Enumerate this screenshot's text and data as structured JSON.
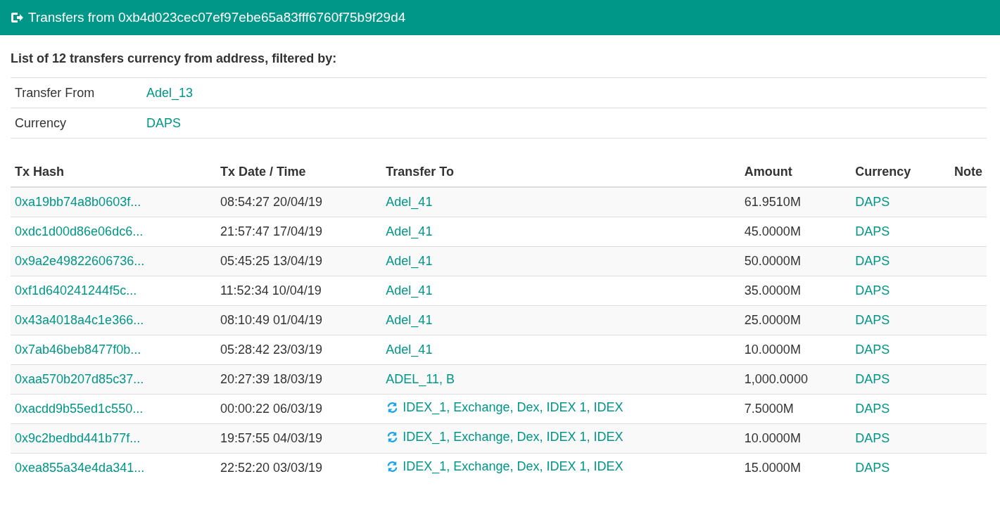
{
  "header": {
    "title": "Transfers from 0xb4d023cec07ef97ebe65a83fff6760f75b9f29d4"
  },
  "summary": {
    "heading": "List of 12 transfers currency from address, filtered by:",
    "filters": [
      {
        "label": "Transfer From",
        "value": "Adel_13"
      },
      {
        "label": "Currency",
        "value": "DAPS"
      }
    ]
  },
  "table": {
    "columns": [
      "Tx Hash",
      "Tx Date / Time",
      "Transfer To",
      "Amount",
      "Currency",
      "Note"
    ],
    "rows": [
      {
        "hash": "0xa19bb74a8b0603f...",
        "time": "08:54:27 20/04/19",
        "to": "Adel_41",
        "exchange": false,
        "amount": "61.9510M",
        "currency": "DAPS"
      },
      {
        "hash": "0xdc1d00d86e06dc6...",
        "time": "21:57:47 17/04/19",
        "to": "Adel_41",
        "exchange": false,
        "amount": "45.0000M",
        "currency": "DAPS"
      },
      {
        "hash": "0x9a2e49822606736...",
        "time": "05:45:25 13/04/19",
        "to": "Adel_41",
        "exchange": false,
        "amount": "50.0000M",
        "currency": "DAPS"
      },
      {
        "hash": "0xf1d640241244f5c...",
        "time": "11:52:34 10/04/19",
        "to": "Adel_41",
        "exchange": false,
        "amount": "35.0000M",
        "currency": "DAPS"
      },
      {
        "hash": "0x43a4018a4c1e366...",
        "time": "08:10:49 01/04/19",
        "to": "Adel_41",
        "exchange": false,
        "amount": "25.0000M",
        "currency": "DAPS"
      },
      {
        "hash": "0x7ab46beb8477f0b...",
        "time": "05:28:42 23/03/19",
        "to": "Adel_41",
        "exchange": false,
        "amount": "10.0000M",
        "currency": "DAPS"
      },
      {
        "hash": "0xaa570b207d85c37...",
        "time": "20:27:39 18/03/19",
        "to": "ADEL_11, B",
        "exchange": false,
        "amount": "1,000.0000",
        "currency": "DAPS"
      },
      {
        "hash": "0xacdd9b55ed1c550...",
        "time": "00:00:22 06/03/19",
        "to": "IDEX_1, Exchange, Dex, IDEX 1, IDEX",
        "exchange": true,
        "amount": "7.5000M",
        "currency": "DAPS"
      },
      {
        "hash": "0x9c2bedbd441b77f...",
        "time": "19:57:55 04/03/19",
        "to": "IDEX_1, Exchange, Dex, IDEX 1, IDEX",
        "exchange": true,
        "amount": "10.0000M",
        "currency": "DAPS"
      },
      {
        "hash": "0xea855a34e4da341...",
        "time": "22:52:20 03/03/19",
        "to": "IDEX_1, Exchange, Dex, IDEX 1, IDEX",
        "exchange": true,
        "amount": "15.0000M",
        "currency": "DAPS"
      }
    ]
  }
}
